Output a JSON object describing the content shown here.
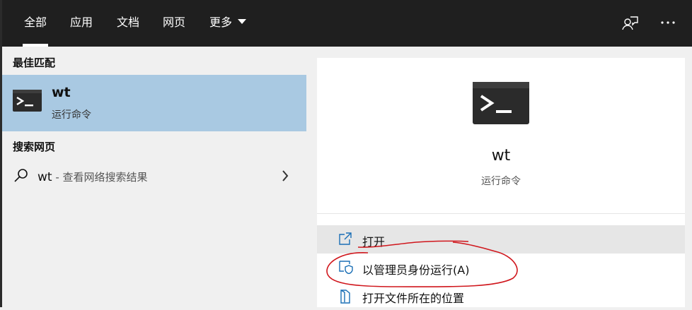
{
  "tabs": [
    {
      "label": "全部"
    },
    {
      "label": "应用"
    },
    {
      "label": "文档"
    },
    {
      "label": "网页"
    },
    {
      "label": "更多"
    }
  ],
  "icons": {
    "feedback": "feedback-person-icon",
    "more": "more-dots-icon",
    "terminal": "terminal-icon",
    "search": "search-icon",
    "chevron": "chevron-right-icon"
  },
  "left": {
    "best_match_title": "最佳匹配",
    "best_match": {
      "name": "wt",
      "type": "运行命令"
    },
    "web_title": "搜索网页",
    "web_query": "wt",
    "web_desc": " - 查看网络搜索结果"
  },
  "right": {
    "name": "wt",
    "type": "运行命令",
    "actions": [
      {
        "label": "打开",
        "icon": "open-external-icon"
      },
      {
        "label": "以管理员身份运行(A)",
        "icon": "shield-admin-icon"
      },
      {
        "label": "打开文件所在的位置",
        "icon": "folder-location-icon"
      }
    ]
  },
  "colors": {
    "topbar": "#1f1f1f",
    "selected": "#a9c9e2",
    "highlight": "#e6e6e6",
    "annotation": "#d0161c"
  }
}
